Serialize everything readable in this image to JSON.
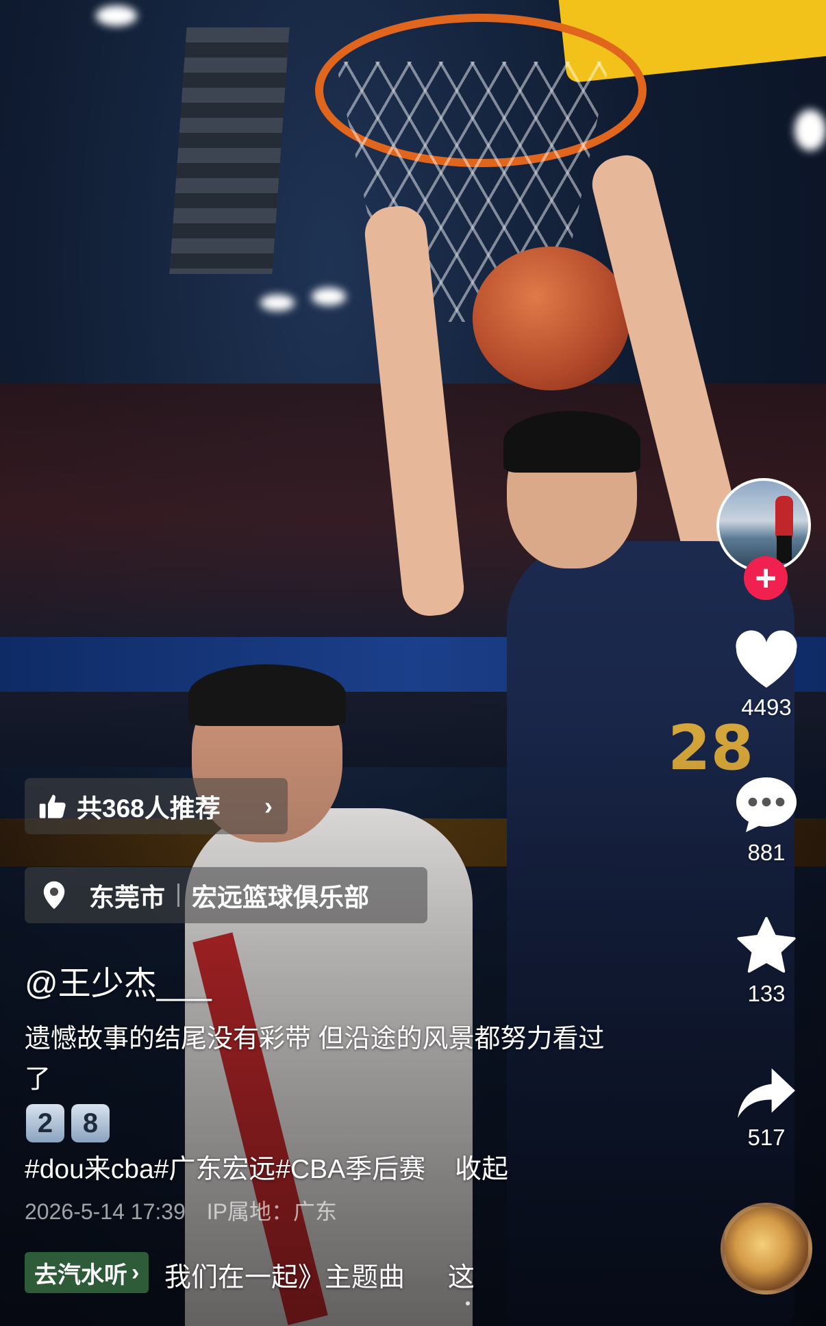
{
  "recommend": {
    "label": "共368人推荐"
  },
  "location": {
    "city": "东莞市",
    "place": "宏远篮球俱乐部"
  },
  "author": {
    "username": "@王少杰___"
  },
  "caption": {
    "text": "遗憾故事的结尾没有彩带  但沿途的风景都努力看过了",
    "keycaps": [
      "2",
      "8"
    ]
  },
  "hashtags": {
    "text": "#dou来cba#广东宏远#CBA季后赛",
    "collapse_label": "收起"
  },
  "meta": {
    "datetime": "2026-5-14 17:39",
    "ip_label": "IP属地：广东"
  },
  "music": {
    "button_label": "去汽水听",
    "title": "我们在一起》主题曲",
    "extra": "这"
  },
  "actions": {
    "likes": "4493",
    "comments": "881",
    "favorites": "133",
    "shares": "517"
  },
  "video": {
    "jersey_number": "28"
  },
  "colors": {
    "follow": "#f0214f",
    "music_button": "#3c7846"
  }
}
